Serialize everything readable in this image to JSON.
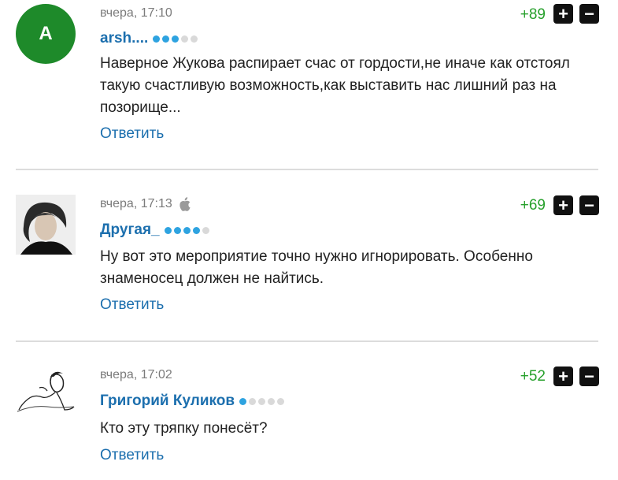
{
  "comments": [
    {
      "time": "вчера, 17:10",
      "author": "arsh....",
      "avatar_letter": "A",
      "rating_dots": 3,
      "score": "+89",
      "text": "Наверное Жукова распирает счас от гордости,не иначе как отстоял такую счастливую возможность,как выставить нас лишний раз на позорище...",
      "reply_label": "Ответить",
      "plus_label": "+",
      "minus_label": "−"
    },
    {
      "time": "вчера, 17:13",
      "author": "Другая_",
      "platform_icon": "apple-icon",
      "rating_dots": 4,
      "score": "+69",
      "text": "Ну вот это мероприятие точно нужно игнорировать. Особенно знаменосец должен не найтись.",
      "reply_label": "Ответить",
      "plus_label": "+",
      "minus_label": "−"
    },
    {
      "time": "вчера, 17:02",
      "author": "Григорий Куликов",
      "rating_dots": 1,
      "score": "+52",
      "text": "Кто эту тряпку понесёт?",
      "reply_label": "Ответить",
      "plus_label": "+",
      "minus_label": "−"
    }
  ],
  "colors": {
    "author": "#1c6fae",
    "score": "#27a02c",
    "avatar_bg": "#1e8a2a",
    "dot_active": "#2ea3e0",
    "dot_inactive": "#d9d9d9"
  }
}
